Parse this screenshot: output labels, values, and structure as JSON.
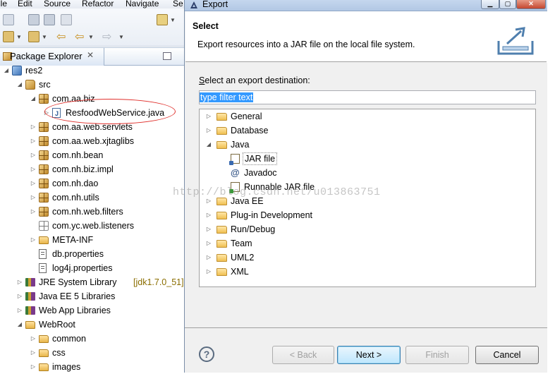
{
  "menubar": {
    "items": [
      "ile",
      "Edit",
      "Source",
      "Refactor",
      "Navigate",
      "Se"
    ]
  },
  "package_explorer": {
    "tab_title": "Package Explorer",
    "tree": [
      {
        "label": "res2",
        "icon": "project-icon",
        "level": 0,
        "twisty": "expanded"
      },
      {
        "label": "src",
        "icon": "source-folder-icon",
        "level": 1,
        "twisty": "expanded"
      },
      {
        "label": "com.aa.biz",
        "icon": "package-icon",
        "level": 2,
        "twisty": "expanded"
      },
      {
        "label": "ResfoodWebService.java",
        "icon": "java-file-icon",
        "level": 3,
        "twisty": "collapsed"
      },
      {
        "label": "com.aa.web.servlets",
        "icon": "package-icon",
        "level": 2,
        "twisty": "collapsed"
      },
      {
        "label": "com.aa.web.xjtaglibs",
        "icon": "package-icon",
        "level": 2,
        "twisty": "collapsed"
      },
      {
        "label": "com.nh.bean",
        "icon": "package-icon",
        "level": 2,
        "twisty": "collapsed"
      },
      {
        "label": "com.nh.biz.impl",
        "icon": "package-icon",
        "level": 2,
        "twisty": "collapsed"
      },
      {
        "label": "com.nh.dao",
        "icon": "package-icon",
        "level": 2,
        "twisty": "collapsed"
      },
      {
        "label": "com.nh.utils",
        "icon": "package-icon",
        "level": 2,
        "twisty": "collapsed"
      },
      {
        "label": "com.nh.web.filters",
        "icon": "package-icon",
        "level": 2,
        "twisty": "collapsed"
      },
      {
        "label": "com.yc.web.listeners",
        "icon": "empty-package-icon",
        "level": 2,
        "twisty": "none"
      },
      {
        "label": "META-INF",
        "icon": "folder-icon",
        "level": 2,
        "twisty": "collapsed"
      },
      {
        "label": "db.properties",
        "icon": "properties-file-icon",
        "level": 2,
        "twisty": "none"
      },
      {
        "label": "log4j.properties",
        "icon": "properties-file-icon",
        "level": 2,
        "twisty": "none"
      },
      {
        "label": "JRE System Library",
        "suffix": "[jdk1.7.0_51]",
        "icon": "library-icon",
        "level": 1,
        "twisty": "collapsed"
      },
      {
        "label": "Java EE 5 Libraries",
        "icon": "library-icon",
        "level": 1,
        "twisty": "collapsed"
      },
      {
        "label": "Web App Libraries",
        "icon": "library-icon",
        "level": 1,
        "twisty": "collapsed"
      },
      {
        "label": "WebRoot",
        "icon": "webroot-folder-icon",
        "level": 1,
        "twisty": "expanded"
      },
      {
        "label": "common",
        "icon": "folder-icon",
        "level": 2,
        "twisty": "collapsed"
      },
      {
        "label": "css",
        "icon": "folder-icon",
        "level": 2,
        "twisty": "collapsed"
      },
      {
        "label": "images",
        "icon": "folder-icon",
        "level": 2,
        "twisty": "collapsed"
      }
    ]
  },
  "dialog": {
    "title": "Export",
    "header_title": "Select",
    "header_description": "Export resources into a JAR file on the local file system.",
    "destination_label": "Select an export destination:",
    "filter": {
      "value": "type filter text"
    },
    "destinations": [
      {
        "label": "General",
        "icon": "folder-icon",
        "level": 0,
        "twisty": "collapsed"
      },
      {
        "label": "Database",
        "icon": "folder-icon",
        "level": 0,
        "twisty": "collapsed"
      },
      {
        "label": "Java",
        "icon": "folder-icon",
        "level": 0,
        "twisty": "expanded"
      },
      {
        "label": "JAR file",
        "icon": "jar-file-icon",
        "level": 1,
        "twisty": "none"
      },
      {
        "label": "Javadoc",
        "icon": "javadoc-icon",
        "level": 1,
        "twisty": "none"
      },
      {
        "label": "Runnable JAR file",
        "icon": "runnable-jar-icon",
        "level": 1,
        "twisty": "none"
      },
      {
        "label": "Java EE",
        "icon": "folder-icon",
        "level": 0,
        "twisty": "collapsed"
      },
      {
        "label": "Plug-in Development",
        "icon": "folder-icon",
        "level": 0,
        "twisty": "collapsed"
      },
      {
        "label": "Run/Debug",
        "icon": "folder-icon",
        "level": 0,
        "twisty": "collapsed"
      },
      {
        "label": "Team",
        "icon": "folder-icon",
        "level": 0,
        "twisty": "collapsed"
      },
      {
        "label": "UML2",
        "icon": "folder-icon",
        "level": 0,
        "twisty": "collapsed"
      },
      {
        "label": "XML",
        "icon": "folder-icon",
        "level": 0,
        "twisty": "collapsed"
      }
    ],
    "buttons": {
      "help": "?",
      "back": "< Back",
      "next": "Next >",
      "finish": "Finish",
      "cancel": "Cancel"
    }
  },
  "watermark": "http://blog.csdn.net/u013863751",
  "colors": {
    "selection": "#3399ff",
    "annotation_oval": "#e0302c",
    "dialog_bg": "#f0f0f0"
  }
}
